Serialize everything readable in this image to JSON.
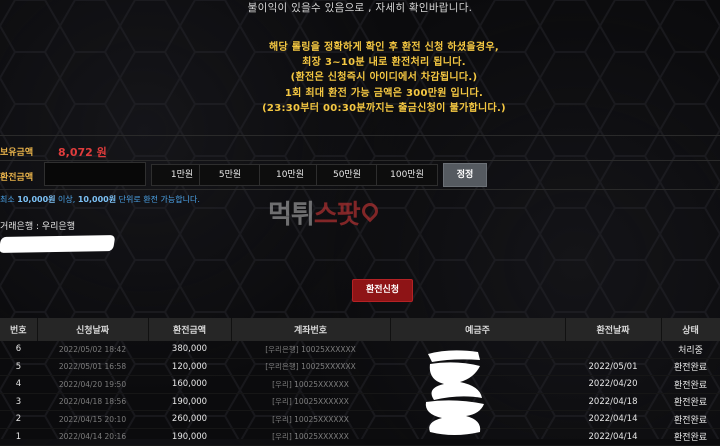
{
  "notice": {
    "top_line": "불이익이 있을수 있음으로 , 자세히 확인바랍니다.",
    "lines": [
      "해당 롤링을 정확하게 확인 후 환전 신청 하셨을경우,",
      "최장 3~10분 내로 환전처리 됩니다.",
      "(환전은 신청즉시 아이디에서 차감됩니다.)",
      "1회 최대 환전 가능 금액은 300만원 입니다.",
      "(23:30부터 00:30분까지는 출금신청이 불가합니다.)"
    ]
  },
  "balance": {
    "label": "보유금액",
    "value": "8,072 원"
  },
  "withdraw": {
    "label": "환전금액",
    "input_value": "",
    "amount_buttons": [
      "1만원",
      "5만원",
      "10만원",
      "50만원",
      "100만원"
    ],
    "reset_label": "정정"
  },
  "hint": {
    "prefix": "최소 ",
    "min": "10,000원",
    "middle": " 이상, ",
    "unit": "10,000원",
    "suffix": " 단위로 환전 가능합니다."
  },
  "watermark": {
    "part1": "먹튀",
    "part2": "스팟"
  },
  "bank": {
    "label": "거래은행 : 우리은행"
  },
  "submit_label": "환전신청",
  "history": {
    "columns": [
      "번호",
      "신청날짜",
      "환전금액",
      "계좌번호",
      "예금주",
      "환전날짜",
      "상태"
    ],
    "rows": [
      {
        "no": "6",
        "date": "2022/05/02 18:42",
        "amount": "380,000",
        "account": "[우리은행] 10025XXXXXX",
        "holder": "",
        "proc_date": "",
        "status": "처리중"
      },
      {
        "no": "5",
        "date": "2022/05/01 16:58",
        "amount": "120,000",
        "account": "[우리은행] 10025XXXXXX",
        "holder": "",
        "proc_date": "2022/05/01",
        "status": "환전완료"
      },
      {
        "no": "4",
        "date": "2022/04/20 19:50",
        "amount": "160,000",
        "account": "[우리] 10025XXXXXX",
        "holder": "",
        "proc_date": "2022/04/20",
        "status": "환전완료"
      },
      {
        "no": "3",
        "date": "2022/04/18 18:56",
        "amount": "190,000",
        "account": "[우리] 10025XXXXXX",
        "holder": "",
        "proc_date": "2022/04/18",
        "status": "환전완료"
      },
      {
        "no": "2",
        "date": "2022/04/15 20:10",
        "amount": "260,000",
        "account": "[우리] 10025XXXXXX",
        "holder": "",
        "proc_date": "2022/04/14",
        "status": "환전완료"
      },
      {
        "no": "1",
        "date": "2022/04/14 20:16",
        "amount": "190,000",
        "account": "[우리] 10025XXXXXX",
        "holder": "",
        "proc_date": "2022/04/14",
        "status": "환전완료"
      }
    ]
  }
}
